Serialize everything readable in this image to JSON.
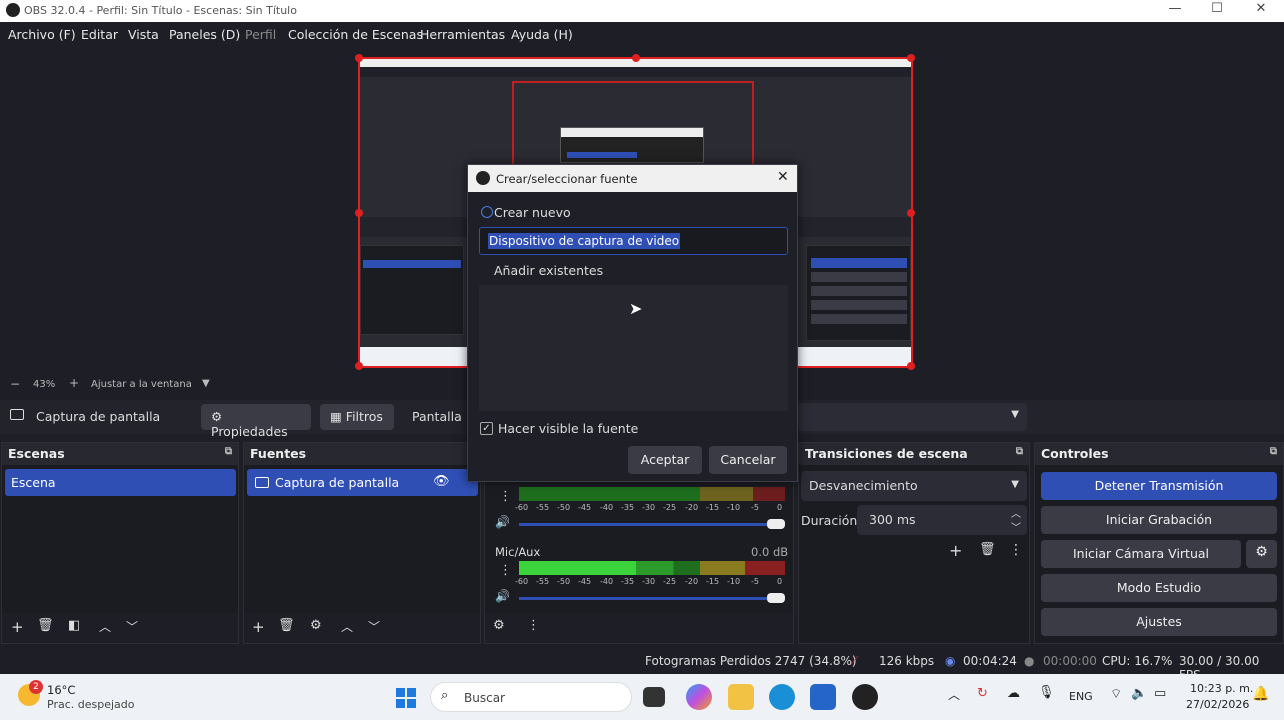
{
  "window": {
    "title": "OBS 32.0.4 - Perfil: Sin Título - Escenas: Sin Título",
    "minimize": "—",
    "maximize": "☐",
    "close": "✕"
  },
  "menu": [
    "Archivo (F)",
    "Editar",
    "Vista",
    "Paneles (D)",
    "Perfil",
    "Colección de Escenas",
    "Herramientas",
    "Ayuda (H)"
  ],
  "zoom": {
    "minus": "−",
    "value": "43%",
    "plus": "+",
    "fit": "Ajustar a la ventana"
  },
  "source_toolbar": {
    "source": "Captura de pantalla",
    "properties": "Propiedades",
    "filters": "Filtros",
    "display": "Pantalla"
  },
  "scenes": {
    "title": "Escenas",
    "items": [
      "Escena"
    ]
  },
  "sources": {
    "title": "Fuentes",
    "items": [
      "Captura de pantalla"
    ]
  },
  "mixer": {
    "channel2": "Mic/Aux",
    "channel2_db": "0.0 dB",
    "ticks": [
      "-60",
      "-55",
      "-50",
      "-45",
      "-40",
      "-35",
      "-30",
      "-25",
      "-20",
      "-15",
      "-10",
      "-5",
      "0"
    ]
  },
  "transitions": {
    "title": "Transiciones de escena",
    "selected": "Desvanecimiento",
    "duration_label": "Duración",
    "duration_value": "300 ms"
  },
  "controls": {
    "title": "Controles",
    "stop_stream": "Detener Transmisión",
    "start_record": "Iniciar Grabación",
    "virtual_cam": "Iniciar Cámara Virtual",
    "studio": "Modo Estudio",
    "settings": "Ajustes"
  },
  "status": {
    "dropped": "Fotogramas Perdidos 2747 (34.8%)",
    "bitrate": "126 kbps",
    "stream_time": "00:04:24",
    "rec_time": "00:00:00",
    "cpu": "CPU: 16.7%",
    "fps": "30.00 / 30.00 FPS"
  },
  "dialog": {
    "title": "Crear/seleccionar fuente",
    "create_new": "Crear nuevo",
    "name_value": "Dispositivo de captura de video",
    "add_existing": "Añadir existentes",
    "visible": "Hacer visible la fuente",
    "accept": "Aceptar",
    "cancel": "Cancelar"
  },
  "taskbar": {
    "weather_temp": "16°C",
    "weather_desc": "Prac. despejado",
    "weather_badge": "2",
    "search": "Buscar",
    "lang": "ENG",
    "time": "10:23 p. m.",
    "date": "27/02/2026"
  },
  "colors": {
    "accent": "#2f4fb5",
    "record_red": "#e02020",
    "meter_green": "#2fc02f",
    "meter_yellow": "#c8b400",
    "meter_red": "#b02020"
  }
}
